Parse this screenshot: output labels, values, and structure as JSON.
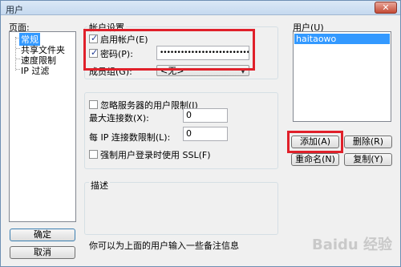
{
  "window": {
    "title": "用户",
    "close_glyph": "✕"
  },
  "pages": {
    "label": "页面:",
    "items": [
      "常规",
      "共享文件夹",
      "速度限制",
      "IP 过滤"
    ]
  },
  "account": {
    "group_label": "帐户设置",
    "enable_label": "启用帐户(E)",
    "password_label": "密码(P):",
    "password_value": "••••••••••••••••••••••••••",
    "group_member_label": "成员组(G):",
    "group_select_value": "<无>"
  },
  "limits": {
    "bypass_label": "忽略服务器的用户限制(I)",
    "max_conn_label": "最大连接数(X):",
    "max_conn_value": "0",
    "per_ip_label": "每 IP 连接数限制(L):",
    "per_ip_value": "0",
    "ssl_label": "强制用户登录时使用 SSL(F)"
  },
  "users": {
    "label": "用户(U)",
    "items": [
      "haitaowo"
    ],
    "add_label": "添加(A)",
    "delete_label": "删除(R)",
    "rename_label": "重命名(N)",
    "copy_label": "复制(Y)"
  },
  "description": {
    "label": "描述",
    "hint": "你可以为上面的用户输入一些备注信息"
  },
  "footer": {
    "ok_label": "确定",
    "cancel_label": "取消"
  },
  "watermark": "Baidu 经验",
  "colors": {
    "highlight": "#3399ff",
    "annotation_red": "#e0202a"
  }
}
